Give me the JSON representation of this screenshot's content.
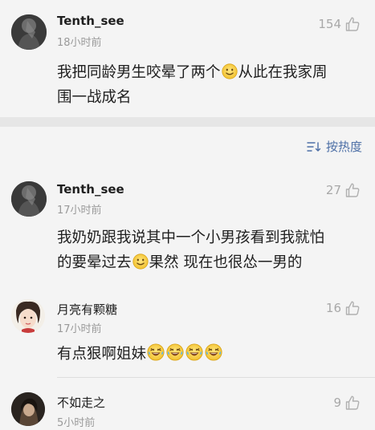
{
  "comments": [
    {
      "username": "Tenth_see",
      "time": "18小时前",
      "likes": "154",
      "text_line1": "我把同龄男生咬晕了两个",
      "text_line1b": "从此在我家周",
      "text_line2": "围一战成名"
    },
    {
      "username": "Tenth_see",
      "time": "17小时前",
      "likes": "27",
      "text_line1": "我奶奶跟我说其中一个小男孩看到我就怕",
      "text_line2a": "的要晕过去",
      "text_line2b": "果然 现在也很怂一男的"
    },
    {
      "username": "月亮有颗糖",
      "time": "17小时前",
      "likes": "16",
      "text": "有点狠啊姐妹"
    },
    {
      "username": "不如走之",
      "time": "5小时前",
      "likes": "9"
    }
  ],
  "sort": {
    "label": "按热度"
  },
  "icons": {
    "like": "thumbs-up-icon",
    "smile": "smile-emoji-icon",
    "laugh_cry": "laugh-cry-emoji-icon",
    "sort": "sort-icon"
  }
}
